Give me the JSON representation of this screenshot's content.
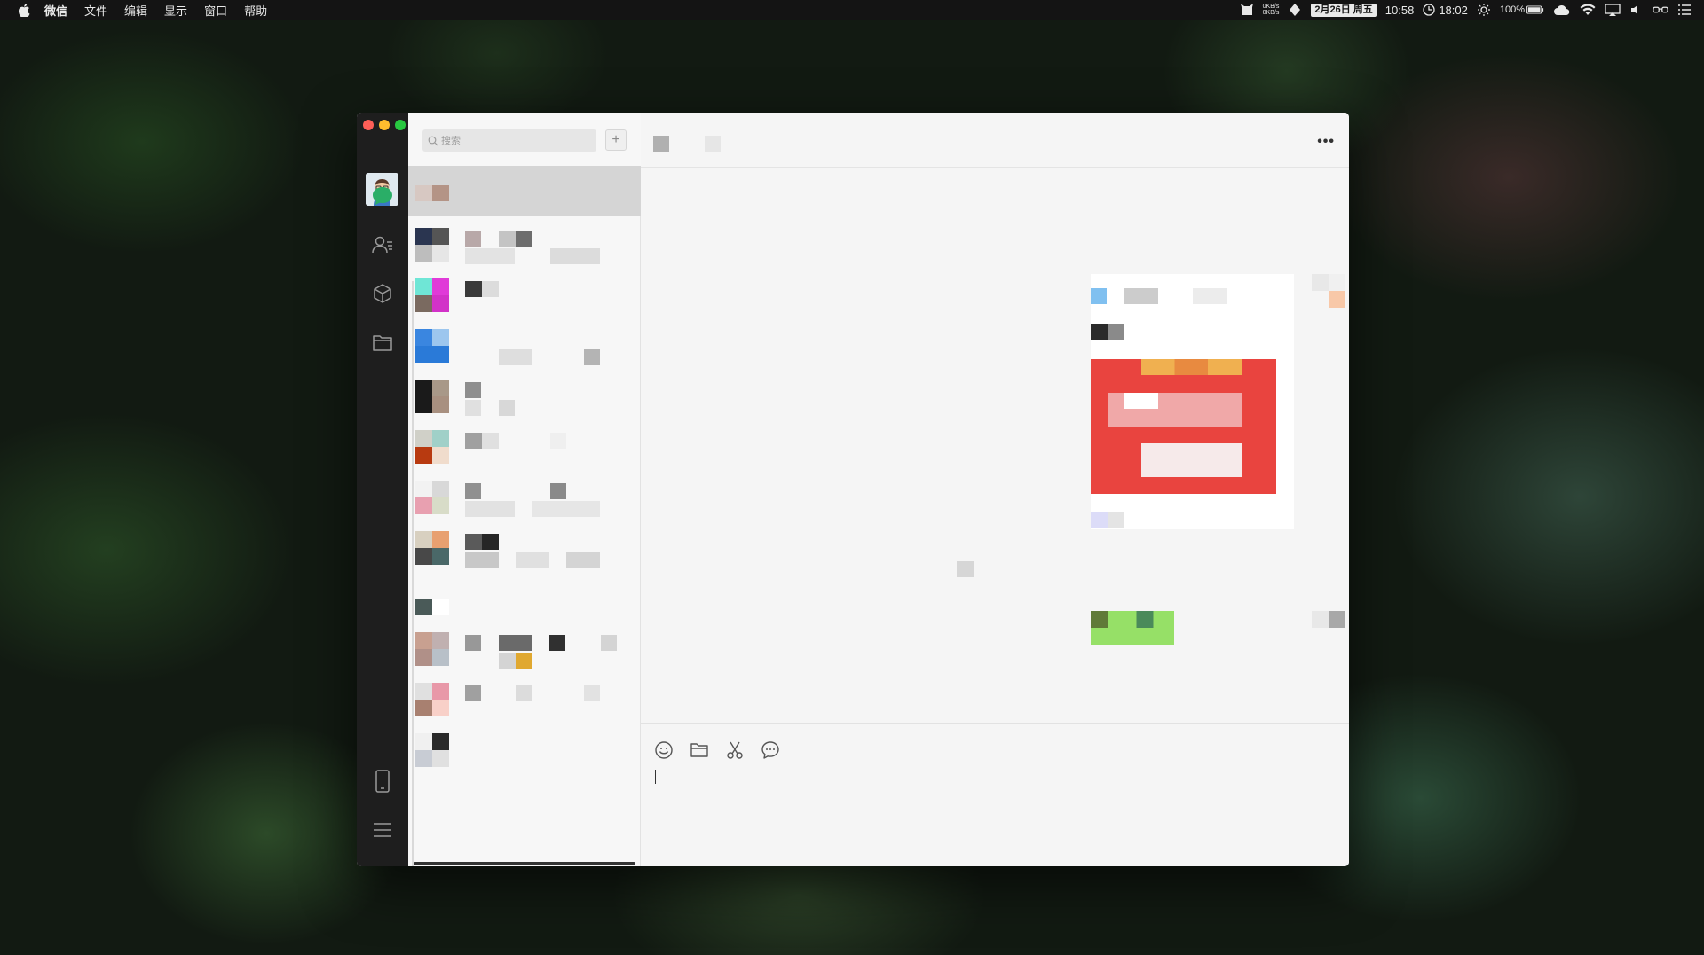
{
  "menubar": {
    "app_name": "微信",
    "menus": [
      "文件",
      "编辑",
      "显示",
      "窗口",
      "帮助"
    ],
    "net_up": "0KB/s",
    "net_down": "0KB/s",
    "date": "2月26日 周五",
    "time": "10:58",
    "clock_time": "18:02",
    "battery": "100%"
  },
  "window": {
    "traffic_colors": [
      "#ff5f57",
      "#febc2e",
      "#28c840"
    ],
    "nav": {
      "accent": "#2aae67",
      "icons": [
        "chat-icon",
        "contacts-icon",
        "favorites-icon",
        "files-icon",
        "phone-icon",
        "menu-icon"
      ]
    },
    "search": {
      "placeholder": "搜索",
      "add_label": "+"
    },
    "chat": {
      "more_label": "•••"
    }
  }
}
